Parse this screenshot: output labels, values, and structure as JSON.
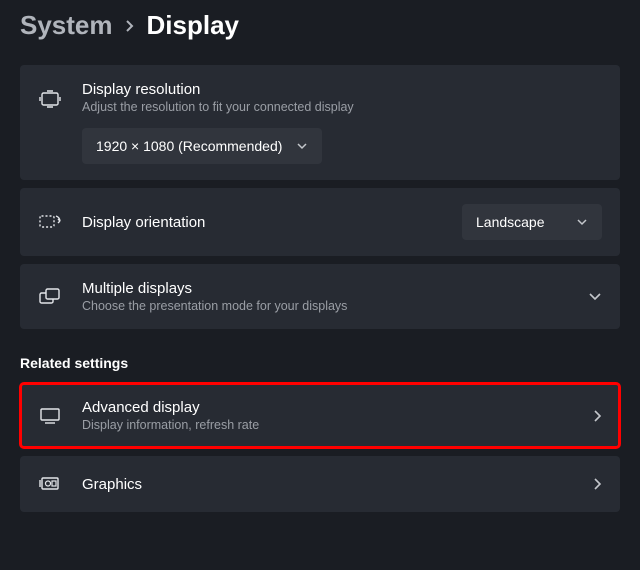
{
  "breadcrumb": {
    "parent": "System",
    "current": "Display"
  },
  "resolution": {
    "title": "Display resolution",
    "desc": "Adjust the resolution to fit your connected display",
    "selected": "1920 × 1080 (Recommended)"
  },
  "orientation": {
    "title": "Display orientation",
    "selected": "Landscape"
  },
  "multiple": {
    "title": "Multiple displays",
    "desc": "Choose the presentation mode for your displays"
  },
  "related_heading": "Related settings",
  "advanced": {
    "title": "Advanced display",
    "desc": "Display information, refresh rate"
  },
  "graphics": {
    "title": "Graphics"
  }
}
